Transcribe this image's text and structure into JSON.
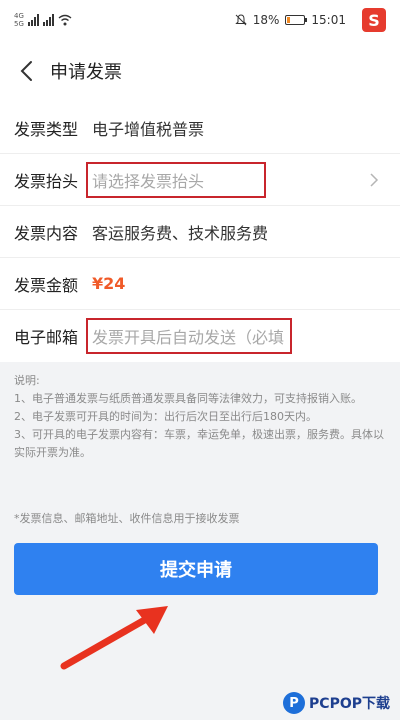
{
  "status_bar": {
    "sim1": "4G",
    "sim2": "5G",
    "battery_level": "18%",
    "battery_fraction": 0.18,
    "time": "15:01",
    "app_badge": "S"
  },
  "nav": {
    "title": "申请发票"
  },
  "form": {
    "invoice_type_label": "发票类型",
    "invoice_type_value": "电子增值税普票",
    "invoice_header_label": "发票抬头",
    "invoice_header_placeholder": "请选择发票抬头",
    "invoice_content_label": "发票内容",
    "invoice_content_value": "客运服务费、技术服务费",
    "invoice_amount_label": "发票金额",
    "invoice_amount_value": "¥24",
    "email_label": "电子邮箱",
    "email_placeholder": "发票开具后自动发送（必填"
  },
  "notes": {
    "title": "说明:",
    "line1": "1、电子普通发票与纸质普通发票具备同等法律效力，可支持报销入账。",
    "line2": "2、电子发票可开具的时间为：出行后次日至出行后180天内。",
    "line3": "3、可开具的电子发票内容有：车票，幸运免单，极速出票，服务费。具体以实际开票为准。"
  },
  "tip": "*发票信息、邮箱地址、收件信息用于接收发票",
  "submit_label": "提交申请",
  "watermark": {
    "logo": "P",
    "text": "PCPOP下载"
  },
  "colors": {
    "accent": "#2f81f0",
    "highlight_box": "#c8252c",
    "amount": "#f05a28",
    "arrow": "#e8321f"
  }
}
